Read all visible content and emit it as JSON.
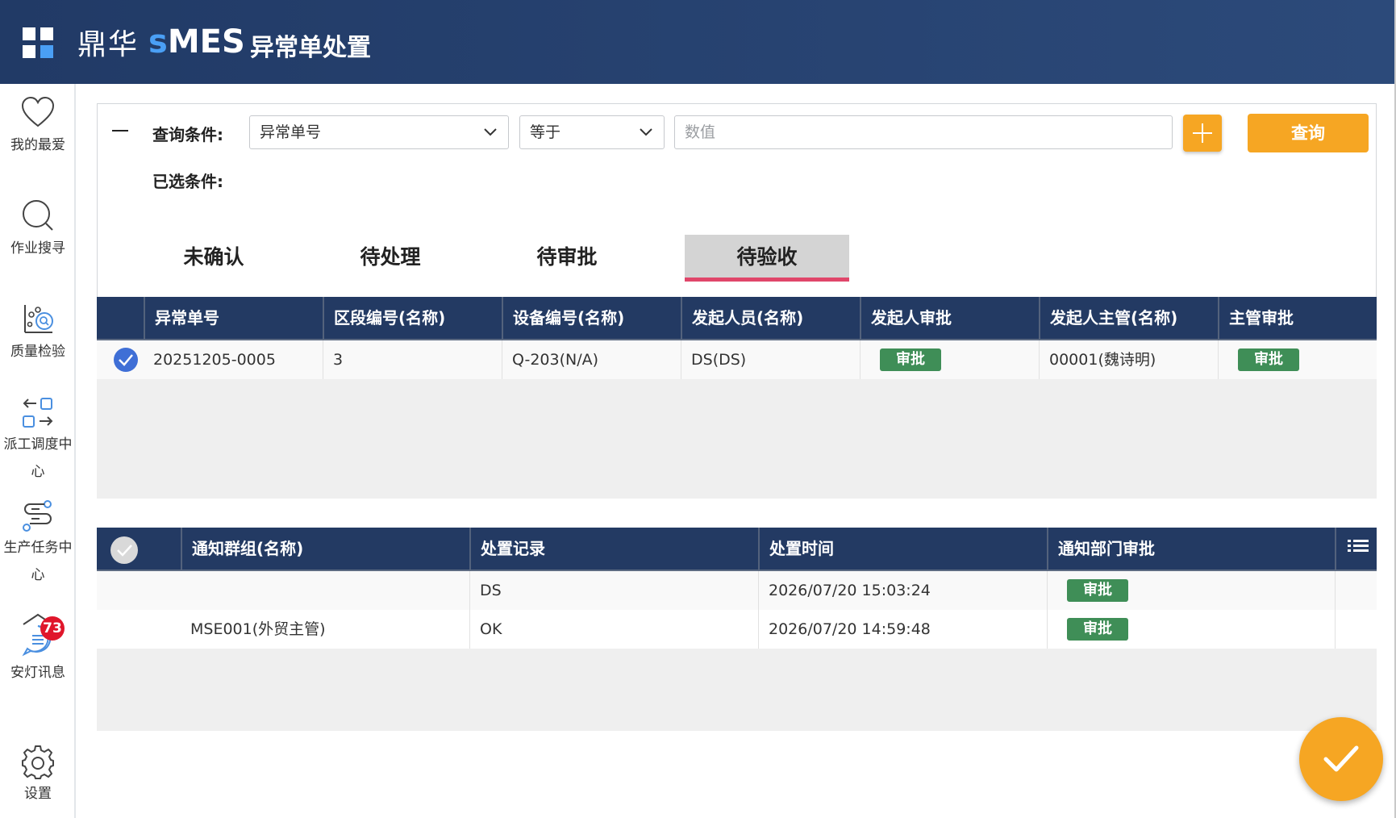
{
  "header": {
    "brand_cn": "鼎华",
    "brand_s": "s",
    "brand_mes": "MES",
    "title": "异常单处置"
  },
  "sidebar": {
    "items": [
      {
        "label": "我的最爱",
        "icon": "heart-icon"
      },
      {
        "label": "作业搜寻",
        "icon": "search-icon"
      },
      {
        "label": "质量检验",
        "icon": "quality-inspect-icon"
      },
      {
        "label": "派工调度中心",
        "icon": "dispatch-icon"
      },
      {
        "label": "生产任务中心",
        "icon": "production-task-icon"
      },
      {
        "label": "安灯讯息",
        "icon": "message-icon",
        "badge": "73"
      },
      {
        "label": "设置",
        "icon": "gear-icon"
      }
    ]
  },
  "query": {
    "condition_label": "查询条件:",
    "selected_label": "已选条件:",
    "field_select": "异常单号",
    "operator_select": "等于",
    "value_placeholder": "数值",
    "query_button": "查询"
  },
  "tabs": [
    {
      "label": "未确认",
      "active": false
    },
    {
      "label": "待处理",
      "active": false
    },
    {
      "label": "待审批",
      "active": false
    },
    {
      "label": "待验收",
      "active": true
    }
  ],
  "table1": {
    "headers": [
      "异常单号",
      "区段编号(名称)",
      "设备编号(名称)",
      "发起人员(名称)",
      "发起人审批",
      "发起人主管(名称)",
      "主管审批"
    ],
    "rows": [
      {
        "checked": true,
        "cells": [
          "20251205-0005",
          "3",
          "Q-203(N/A)",
          "DS(DS)",
          "审批",
          "00001(魏诗明)",
          "审批"
        ]
      }
    ]
  },
  "table2": {
    "headers": [
      "通知群组(名称)",
      "处置记录",
      "处置时间",
      "通知部门审批"
    ],
    "rows": [
      {
        "cells": [
          "",
          "DS",
          "2026/07/20 15:03:24",
          "审批"
        ]
      },
      {
        "cells": [
          "MSE001(外贸主管)",
          "OK",
          "2026/07/20 14:59:48",
          "审批"
        ]
      }
    ]
  },
  "colors": {
    "header_bg": "#233a63",
    "accent": "#f6a623",
    "approve": "#3f8e57",
    "tab_underline": "#e0466a",
    "badge": "#e0162b"
  }
}
